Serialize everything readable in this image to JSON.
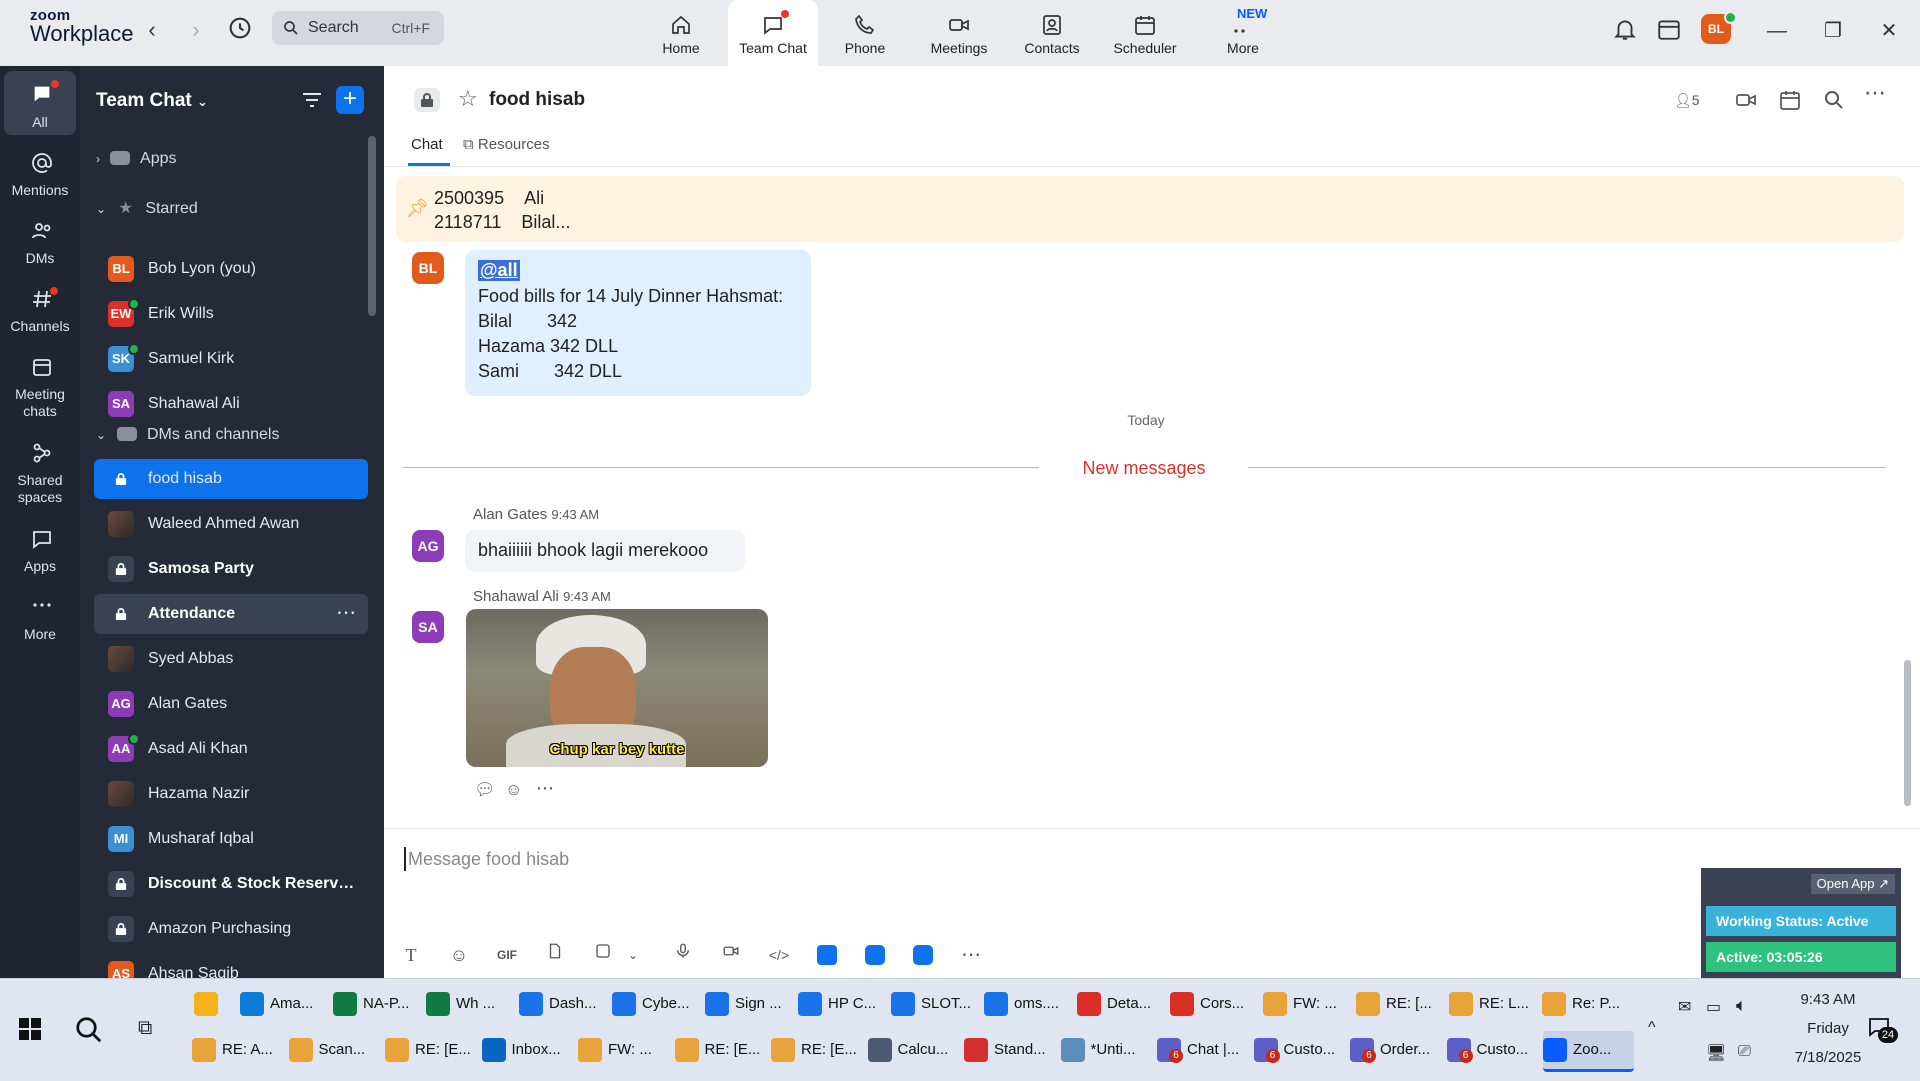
{
  "app": {
    "logo_line1": "zoom",
    "logo_line2": "Workplace"
  },
  "search": {
    "label": "Search",
    "shortcut": "Ctrl+F"
  },
  "nav_tabs": [
    {
      "label": "Home"
    },
    {
      "label": "Team Chat"
    },
    {
      "label": "Phone"
    },
    {
      "label": "Meetings"
    },
    {
      "label": "Contacts"
    },
    {
      "label": "Scheduler"
    },
    {
      "label": "More"
    }
  ],
  "new_badge": "NEW",
  "profile": {
    "initials": "BL",
    "color": "#e25a1c"
  },
  "rail": [
    {
      "label": "All"
    },
    {
      "label": "Mentions"
    },
    {
      "label": "DMs"
    },
    {
      "label": "Channels"
    },
    {
      "label": "Meeting chats",
      "line1": "Meeting",
      "line2": "chats"
    },
    {
      "label": "Shared spaces",
      "line1": "Shared",
      "line2": "spaces"
    },
    {
      "label": "Apps"
    },
    {
      "label": "More"
    }
  ],
  "sidebar": {
    "title": "Team Chat",
    "sections": {
      "apps": "Apps",
      "starred": "Starred",
      "dms": "DMs and channels"
    },
    "starred": [
      {
        "name": "Bob Lyon (you)",
        "initials": "BL",
        "color": "#e25a1c"
      },
      {
        "name": "Erik Wills",
        "initials": "EW",
        "color": "#d9322b"
      },
      {
        "name": "Samuel Kirk",
        "initials": "SK",
        "color": "#3c8fd1"
      },
      {
        "name": "Shahawal Ali",
        "initials": "SA",
        "color": "#8e3bb8"
      }
    ],
    "channels": [
      {
        "name": "food hisab",
        "type": "lock"
      },
      {
        "name": "Waleed Ahmed Awan",
        "type": "photo"
      },
      {
        "name": "Samosa Party",
        "type": "lock"
      },
      {
        "name": "Attendance",
        "type": "lock"
      },
      {
        "name": "Syed Abbas",
        "type": "photo"
      },
      {
        "name": "Alan Gates",
        "initials": "AG",
        "color": "#8e3bb8"
      },
      {
        "name": "Asad Ali Khan",
        "initials": "AA",
        "color": "#8e3bb8"
      },
      {
        "name": "Hazama Nazir",
        "type": "photo"
      },
      {
        "name": "Musharaf Iqbal",
        "initials": "MI",
        "color": "#3c8fd1"
      },
      {
        "name": "Discount & Stock Reserva...",
        "type": "lock"
      },
      {
        "name": "Amazon Purchasing",
        "type": "lock"
      },
      {
        "name": "Ahsan Saqib",
        "initials": "AS",
        "color": "#e25a1c"
      }
    ]
  },
  "chat": {
    "title": "food hisab",
    "tabs": {
      "chat": "Chat",
      "resources": "Resources"
    },
    "member_count": "5",
    "pinned": {
      "line1_num": "2500395",
      "line1_name": "Ali",
      "line2_num": "2118711",
      "line2_name": "Bilal..."
    },
    "first_message": {
      "avatar": "BL",
      "mention": "@all",
      "lines": [
        "Food bills for 14 July Dinner Hahsmat:",
        "Bilal       342",
        "Hazama 342 DLL",
        "Sami       342 DLL"
      ]
    },
    "date_divider": "Today",
    "new_messages": "New messages",
    "messages": [
      {
        "sender": "Alan Gates",
        "time": "9:43 AM",
        "avatar": "AG",
        "text": "bhaiiiiii bhook lagii merekooo"
      },
      {
        "sender": "Shahawal Ali",
        "time": "9:43 AM",
        "avatar": "SA",
        "image_caption": "Chup kar bey kutte"
      }
    ],
    "composer_placeholder": "Message food hisab"
  },
  "widget": {
    "open_app": "Open App ↗",
    "working_status": "Working Status: Active",
    "active_time": "Active: 03:05:26"
  },
  "taskbar": {
    "row1": [
      {
        "label": "",
        "color": "#f3b21a"
      },
      {
        "label": "Ama...",
        "color": "#0a7bd8"
      },
      {
        "label": "NA-P...",
        "color": "#107c41"
      },
      {
        "label": "Wh ...",
        "color": "#107c41"
      },
      {
        "label": "Dash...",
        "color": "#1a73e8"
      },
      {
        "label": "Cybe...",
        "color": "#1a73e8"
      },
      {
        "label": "Sign ...",
        "color": "#1a73e8"
      },
      {
        "label": "HP C...",
        "color": "#1a73e8"
      },
      {
        "label": "SLOT...",
        "color": "#1a73e8"
      },
      {
        "label": "oms....",
        "color": "#1a73e8"
      },
      {
        "label": "Deta...",
        "color": "#d93025"
      },
      {
        "label": "Cors...",
        "color": "#d93025"
      },
      {
        "label": "FW: ...",
        "color": "#e8a33a"
      },
      {
        "label": "RE: [...",
        "color": "#e8a33a"
      },
      {
        "label": "RE: L...",
        "color": "#e8a33a"
      },
      {
        "label": "Re: P...",
        "color": "#e8a33a"
      }
    ],
    "row2": [
      {
        "label": "RE: A...",
        "color": "#e8a33a"
      },
      {
        "label": "Scan...",
        "color": "#e8a33a"
      },
      {
        "label": "RE: [E...",
        "color": "#e8a33a"
      },
      {
        "label": "Inbox...",
        "color": "#0a64c2"
      },
      {
        "label": "FW: ...",
        "color": "#e8a33a"
      },
      {
        "label": "RE: [E...",
        "color": "#e8a33a"
      },
      {
        "label": "RE: [E...",
        "color": "#e8a33a"
      },
      {
        "label": "Calcu...",
        "color": "#4a5a70"
      },
      {
        "label": "Stand...",
        "color": "#d32f2f"
      },
      {
        "label": "*Unti...",
        "color": "#5b8db8"
      },
      {
        "label": "Chat |...",
        "color": "#5b5fc7",
        "badge": "6"
      },
      {
        "label": "Custo...",
        "color": "#5b5fc7",
        "badge": "6"
      },
      {
        "label": "Order...",
        "color": "#5b5fc7",
        "badge": "6"
      },
      {
        "label": "Custo...",
        "color": "#5b5fc7",
        "badge": "6"
      },
      {
        "label": "Zoo...",
        "color": "#0b5cff",
        "active": true
      }
    ],
    "clock": {
      "time": "9:43 AM",
      "day": "Friday",
      "date": "7/18/2025"
    },
    "notification_count": "24"
  }
}
